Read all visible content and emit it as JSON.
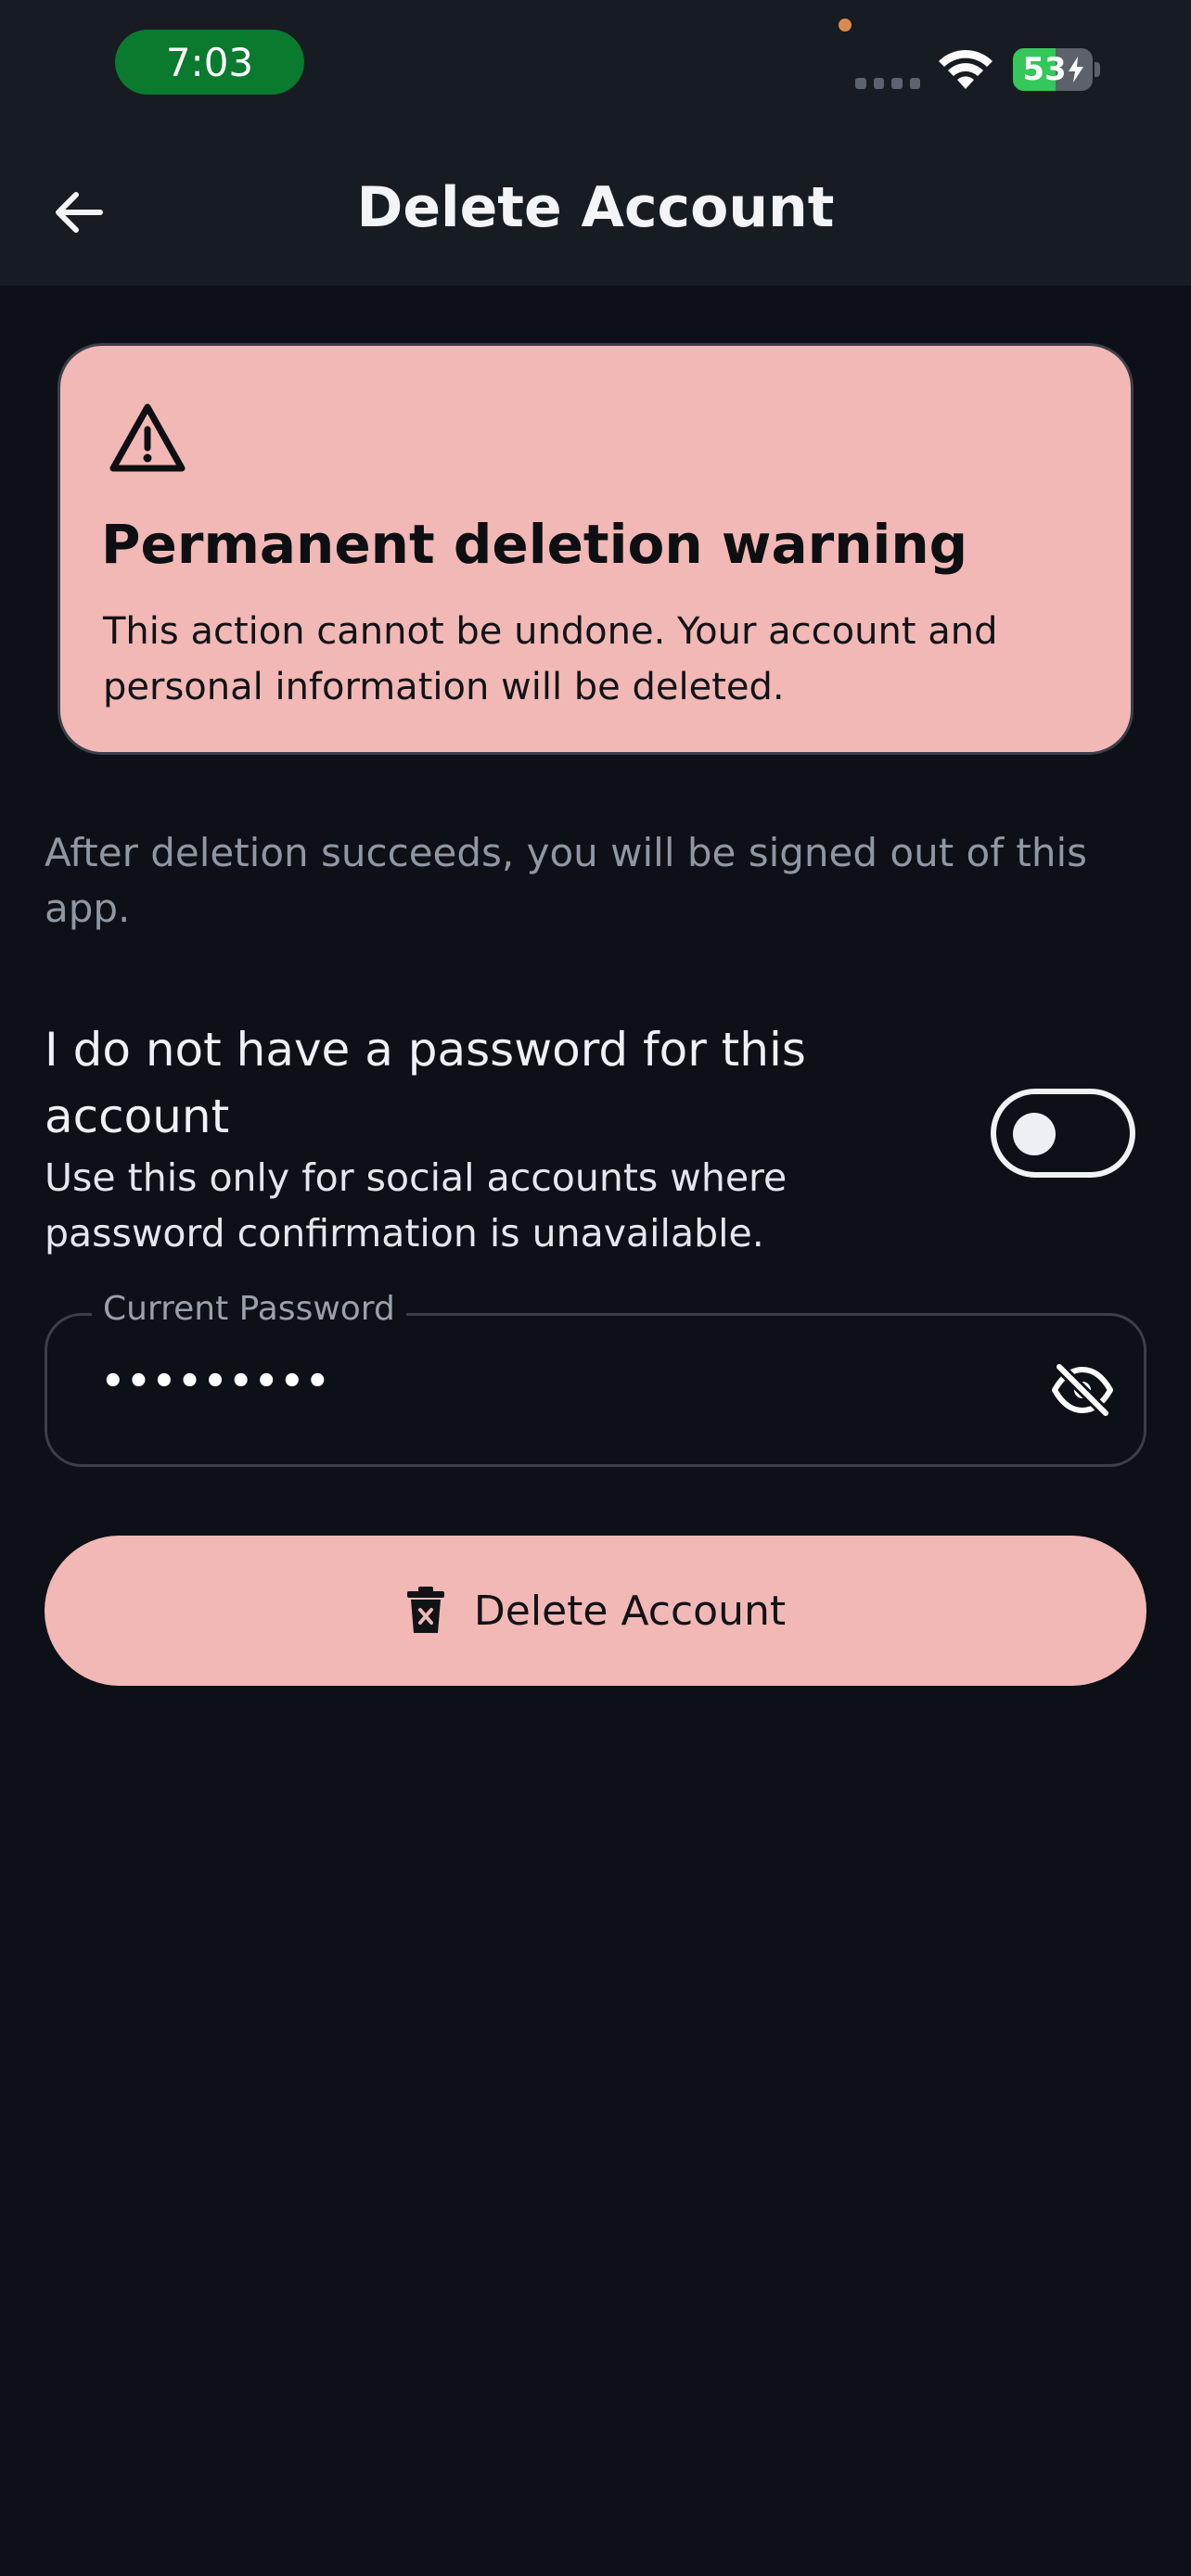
{
  "status_bar": {
    "time": "7:03",
    "battery_level": 53,
    "battery_percent_label": "53",
    "charging": true,
    "colors": {
      "time_pill": "#0a7a2f",
      "battery_fill": "#34c759",
      "camera_dot": "#d98a4f"
    }
  },
  "header": {
    "title": "Delete Account",
    "back_icon": "arrow-left-icon"
  },
  "warning": {
    "icon": "warning-triangle-icon",
    "title": "Permanent deletion warning",
    "body": "This action cannot be undone. Your account and personal information will be deleted.",
    "background_color": "#f2b8b5"
  },
  "info_text": "After deletion succeeds, you will be signed out of this app.",
  "no_password_option": {
    "title": "I do not have a password for this account",
    "subtitle": "Use this only for social accounts where password confirmation is unavailable.",
    "enabled": false
  },
  "password_field": {
    "label": "Current Password",
    "value": "•••••••••",
    "visibility_icon": "eye-off-icon"
  },
  "delete_button": {
    "label": "Delete Account",
    "icon": "trash-icon",
    "background_color": "#f2b8b5"
  },
  "theme": {
    "background": "#0d1017",
    "app_bar": "#171b22",
    "muted_text": "#8f97a3"
  }
}
